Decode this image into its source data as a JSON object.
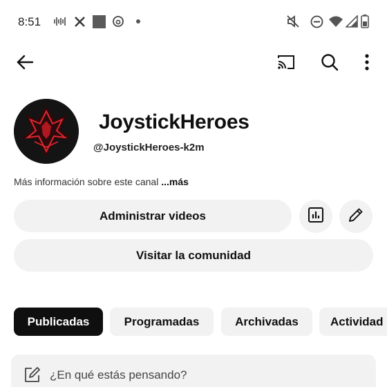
{
  "status_bar": {
    "time": "8:51",
    "left_icons": [
      "wave-icon",
      "x-logo-icon",
      "square-app-icon",
      "threads-icon",
      "dot-icon"
    ],
    "right_icons": [
      "mute-icon",
      "dnd-icon",
      "wifi-icon",
      "signal-icon",
      "battery-icon"
    ]
  },
  "app_bar": {
    "icons": [
      "back-arrow-icon",
      "cast-icon",
      "search-icon",
      "more-vert-icon"
    ]
  },
  "channel": {
    "name": "JoystickHeroes",
    "handle": "@JoystickHeroes-k2m",
    "about_text": "Más información sobre este canal",
    "about_more": "...más"
  },
  "actions": {
    "manage_videos": "Administrar videos",
    "visit_community": "Visitar la comunidad",
    "icons": [
      "analytics-icon",
      "edit-pencil-icon"
    ]
  },
  "tabs": [
    {
      "label": "Publicadas",
      "selected": true
    },
    {
      "label": "Programadas",
      "selected": false
    },
    {
      "label": "Archivadas",
      "selected": false
    },
    {
      "label": "Actividad",
      "selected": false
    }
  ],
  "composer": {
    "placeholder": "¿En qué estás pensando?",
    "icon": "compose-icon"
  },
  "colors": {
    "chip_bg": "#f2f2f2",
    "chip_selected_bg": "#0f0f0f",
    "avatar_accent": "#e0262f"
  }
}
